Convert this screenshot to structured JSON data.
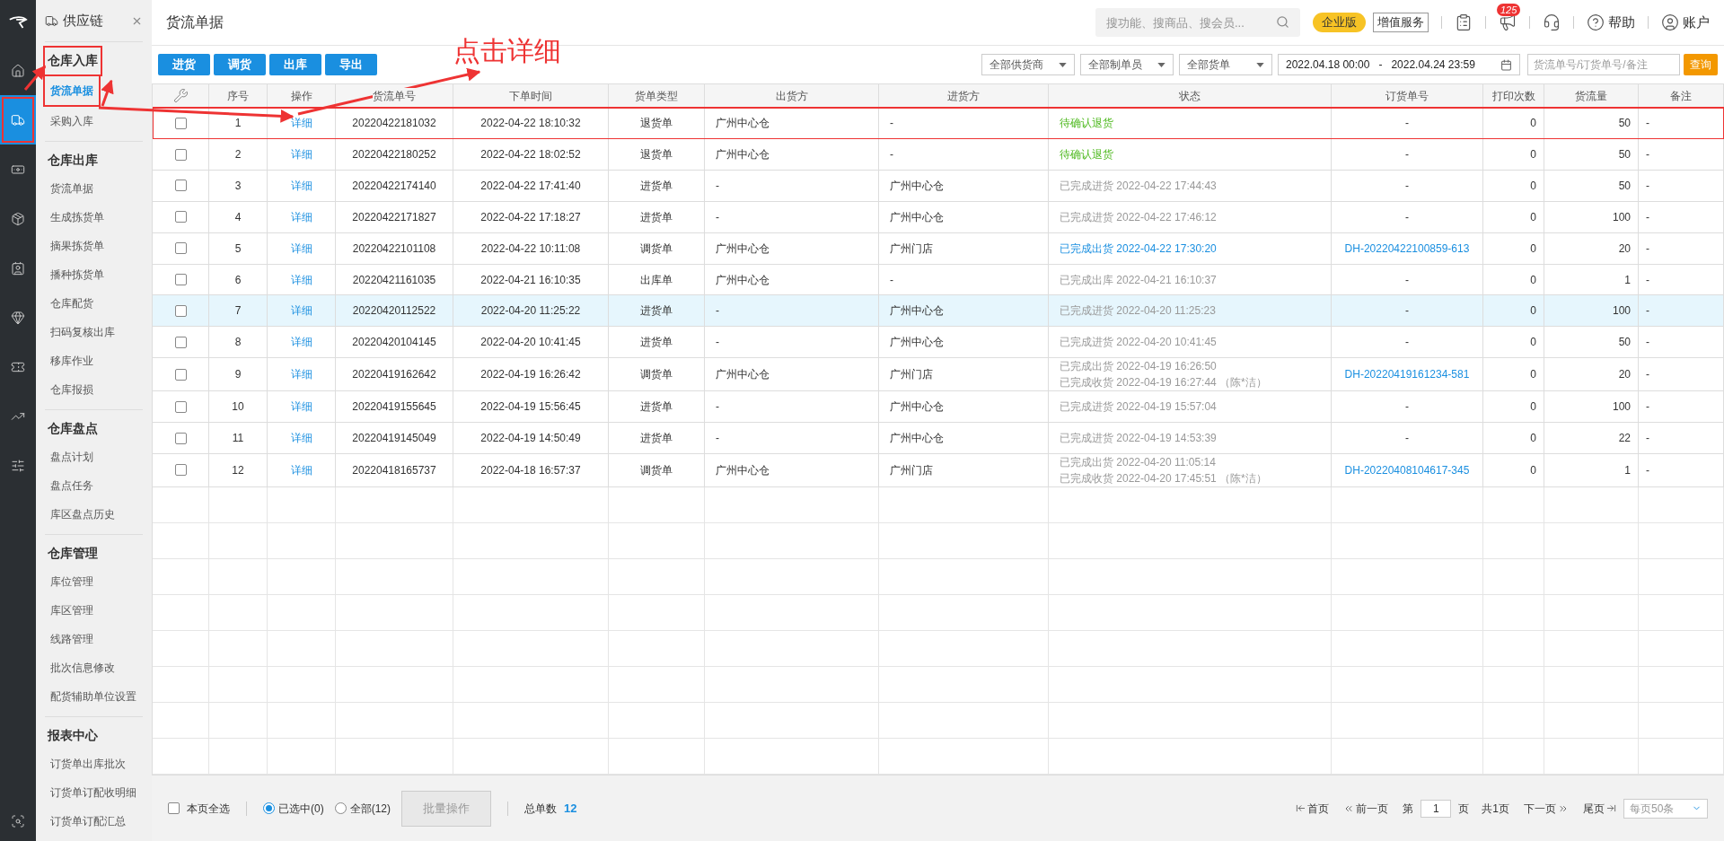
{
  "rail": [
    {
      "selected": false
    },
    {
      "selected": true
    },
    {
      "selected": false
    },
    {
      "selected": false
    },
    {
      "selected": false
    },
    {
      "selected": false
    },
    {
      "selected": false
    },
    {
      "selected": false
    },
    {
      "selected": false
    }
  ],
  "sidebar": {
    "title": "供应链",
    "groups": [
      {
        "title": "仓库入库",
        "annotated": true,
        "items": [
          {
            "label": "货流单据",
            "selected": true,
            "annotated": true
          },
          {
            "label": "采购入库",
            "selected": false,
            "annotated": false
          }
        ]
      },
      {
        "title": "仓库出库",
        "annotated": false,
        "items": [
          {
            "label": "货流单据",
            "selected": false,
            "annotated": false
          },
          {
            "label": "生成拣货单",
            "selected": false,
            "annotated": false
          },
          {
            "label": "摘果拣货单",
            "selected": false,
            "annotated": false
          },
          {
            "label": "播种拣货单",
            "selected": false,
            "annotated": false
          },
          {
            "label": "仓库配货",
            "selected": false,
            "annotated": false
          },
          {
            "label": "扫码复核出库",
            "selected": false,
            "annotated": false
          },
          {
            "label": "移库作业",
            "selected": false,
            "annotated": false
          },
          {
            "label": "仓库报损",
            "selected": false,
            "annotated": false
          }
        ]
      },
      {
        "title": "仓库盘点",
        "annotated": false,
        "items": [
          {
            "label": "盘点计划",
            "selected": false,
            "annotated": false
          },
          {
            "label": "盘点任务",
            "selected": false,
            "annotated": false
          },
          {
            "label": "库区盘点历史",
            "selected": false,
            "annotated": false
          }
        ]
      },
      {
        "title": "仓库管理",
        "annotated": false,
        "items": [
          {
            "label": "库位管理",
            "selected": false,
            "annotated": false
          },
          {
            "label": "库区管理",
            "selected": false,
            "annotated": false
          },
          {
            "label": "线路管理",
            "selected": false,
            "annotated": false
          },
          {
            "label": "批次信息修改",
            "selected": false,
            "annotated": false
          },
          {
            "label": "配货辅助单位设置",
            "selected": false,
            "annotated": false
          }
        ]
      },
      {
        "title": "报表中心",
        "annotated": false,
        "items": [
          {
            "label": "订货单出库批次",
            "selected": false,
            "annotated": false
          },
          {
            "label": "订货单订配收明细",
            "selected": false,
            "annotated": false
          },
          {
            "label": "订货单订配汇总",
            "selected": false,
            "annotated": false
          }
        ]
      }
    ]
  },
  "header": {
    "title": "货流单据",
    "search": {
      "placeholder": "搜功能、搜商品、搜会员..."
    },
    "edition": "企业版",
    "value_service": "增值服务",
    "notifications": "125",
    "help": "帮助",
    "account": "账户"
  },
  "toolbar": {
    "buttons": [
      "进货",
      "调货",
      "出库",
      "导出"
    ],
    "filters": [
      "全部供货商",
      "全部制单员",
      "全部货单"
    ],
    "date_from": "2022.04.18 00:00",
    "date_sep": "-",
    "date_to": "2022.04.24 23:59",
    "search": {
      "placeholder": "货流单号/订货单号/备注"
    },
    "query": "查询"
  },
  "annotation": {
    "text": "点击详细"
  },
  "table": {
    "columns": [
      "序号",
      "操作",
      "货流单号",
      "下单时间",
      "货单类型",
      "出货方",
      "进货方",
      "状态",
      "订货单号",
      "打印次数",
      "货流量",
      "备注"
    ],
    "rows": [
      {
        "checked": false,
        "highlighted": false,
        "annotated": true,
        "no": "1",
        "action": "详细",
        "id": "20220422181032",
        "time": "2022-04-22 18:10:32",
        "type": "退货单",
        "from": "广州中心仓",
        "to": "-",
        "status": {
          "kind": "pending",
          "lines": [
            "待确认退货"
          ]
        },
        "order": "-",
        "prints": "0",
        "qty": "50",
        "note": "-"
      },
      {
        "checked": false,
        "highlighted": false,
        "annotated": false,
        "no": "2",
        "action": "详细",
        "id": "20220422180252",
        "time": "2022-04-22 18:02:52",
        "type": "退货单",
        "from": "广州中心仓",
        "to": "-",
        "status": {
          "kind": "pending",
          "lines": [
            "待确认退货"
          ]
        },
        "order": "-",
        "prints": "0",
        "qty": "50",
        "note": "-"
      },
      {
        "checked": false,
        "highlighted": false,
        "annotated": false,
        "no": "3",
        "action": "详细",
        "id": "20220422174140",
        "time": "2022-04-22 17:41:40",
        "type": "进货单",
        "from": "-",
        "to": "广州中心仓",
        "status": {
          "kind": "done",
          "lines": [
            "已完成进货 2022-04-22 17:44:43"
          ]
        },
        "order": "-",
        "prints": "0",
        "qty": "50",
        "note": "-"
      },
      {
        "checked": false,
        "highlighted": false,
        "annotated": false,
        "no": "4",
        "action": "详细",
        "id": "20220422171827",
        "time": "2022-04-22 17:18:27",
        "type": "进货单",
        "from": "-",
        "to": "广州中心仓",
        "status": {
          "kind": "done",
          "lines": [
            "已完成进货 2022-04-22 17:46:12"
          ]
        },
        "order": "-",
        "prints": "0",
        "qty": "100",
        "note": "-"
      },
      {
        "checked": false,
        "highlighted": false,
        "annotated": false,
        "no": "5",
        "action": "详细",
        "id": "20220422101108",
        "time": "2022-04-22 10:11:08",
        "type": "调货单",
        "from": "广州中心仓",
        "to": "广州门店",
        "status": {
          "kind": "link",
          "lines": [
            "已完成出货 2022-04-22 17:30:20"
          ]
        },
        "order": "DH-20220422100859-613",
        "prints": "0",
        "qty": "20",
        "note": "-"
      },
      {
        "checked": false,
        "highlighted": false,
        "annotated": false,
        "no": "6",
        "action": "详细",
        "id": "20220421161035",
        "time": "2022-04-21 16:10:35",
        "type": "出库单",
        "from": "广州中心仓",
        "to": "-",
        "status": {
          "kind": "done",
          "lines": [
            "已完成出库 2022-04-21 16:10:37"
          ]
        },
        "order": "-",
        "prints": "0",
        "qty": "1",
        "note": "-"
      },
      {
        "checked": false,
        "highlighted": true,
        "annotated": false,
        "no": "7",
        "action": "详细",
        "id": "20220420112522",
        "time": "2022-04-20 11:25:22",
        "type": "进货单",
        "from": "-",
        "to": "广州中心仓",
        "status": {
          "kind": "done",
          "lines": [
            "已完成进货 2022-04-20 11:25:23"
          ]
        },
        "order": "-",
        "prints": "0",
        "qty": "100",
        "note": "-"
      },
      {
        "checked": false,
        "highlighted": false,
        "annotated": false,
        "no": "8",
        "action": "详细",
        "id": "20220420104145",
        "time": "2022-04-20 10:41:45",
        "type": "进货单",
        "from": "-",
        "to": "广州中心仓",
        "status": {
          "kind": "done",
          "lines": [
            "已完成进货 2022-04-20 10:41:45"
          ]
        },
        "order": "-",
        "prints": "0",
        "qty": "50",
        "note": "-"
      },
      {
        "checked": false,
        "highlighted": false,
        "annotated": false,
        "no": "9",
        "action": "详细",
        "id": "20220419162642",
        "time": "2022-04-19 16:26:42",
        "type": "调货单",
        "from": "广州中心仓",
        "to": "广州门店",
        "status": {
          "kind": "done",
          "lines": [
            "已完成出货 2022-04-19 16:26:50",
            "已完成收货 2022-04-19 16:27:44 （陈*洁）"
          ]
        },
        "order": "DH-20220419161234-581",
        "prints": "0",
        "qty": "20",
        "note": "-"
      },
      {
        "checked": false,
        "highlighted": false,
        "annotated": false,
        "no": "10",
        "action": "详细",
        "id": "20220419155645",
        "time": "2022-04-19 15:56:45",
        "type": "进货单",
        "from": "-",
        "to": "广州中心仓",
        "status": {
          "kind": "done",
          "lines": [
            "已完成进货 2022-04-19 15:57:04"
          ]
        },
        "order": "-",
        "prints": "0",
        "qty": "100",
        "note": "-"
      },
      {
        "checked": false,
        "highlighted": false,
        "annotated": false,
        "no": "11",
        "action": "详细",
        "id": "20220419145049",
        "time": "2022-04-19 14:50:49",
        "type": "进货单",
        "from": "-",
        "to": "广州中心仓",
        "status": {
          "kind": "done",
          "lines": [
            "已完成进货 2022-04-19 14:53:39"
          ]
        },
        "order": "-",
        "prints": "0",
        "qty": "22",
        "note": "-"
      },
      {
        "checked": false,
        "highlighted": false,
        "annotated": false,
        "no": "12",
        "action": "详细",
        "id": "20220418165737",
        "time": "2022-04-18 16:57:37",
        "type": "调货单",
        "from": "广州中心仓",
        "to": "广州门店",
        "status": {
          "kind": "done",
          "lines": [
            "已完成出货 2022-04-20 11:05:14",
            "已完成收货 2022-04-20 17:45:51 （陈*洁）"
          ]
        },
        "order": "DH-20220408104617-345",
        "prints": "0",
        "qty": "1",
        "note": "-"
      }
    ]
  },
  "footer": {
    "select_page": {
      "label": "本页全选",
      "checked": false
    },
    "radios": [
      {
        "label": "已选中(0)",
        "selected": true
      },
      {
        "label": "全部(12)",
        "selected": false
      }
    ],
    "batch": {
      "label": "批量操作",
      "disabled": true
    },
    "total_label": "总单数",
    "total": "12",
    "pager": {
      "first": "首页",
      "prev": "前一页",
      "page_prefix": "第",
      "page": "1",
      "page_suffix": "页",
      "count": "共1页",
      "next": "下一页",
      "last": "尾页",
      "per_page": "每页50条"
    }
  }
}
